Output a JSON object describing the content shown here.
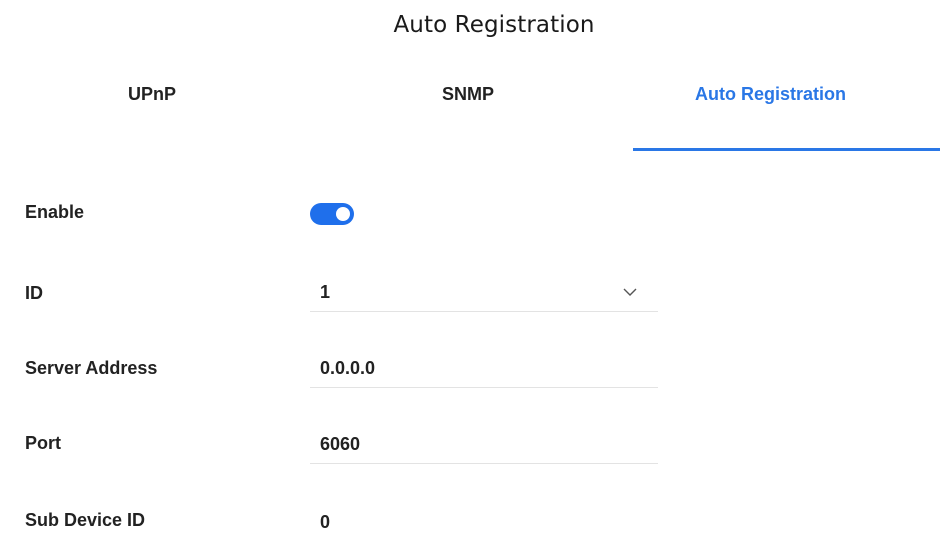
{
  "header": {
    "title": "Auto Registration"
  },
  "tabs": [
    {
      "label": "UPnP",
      "active": false
    },
    {
      "label": "SNMP",
      "active": false
    },
    {
      "label": "Auto Registration",
      "active": true
    }
  ],
  "form": {
    "enable": {
      "label": "Enable",
      "value": true
    },
    "id": {
      "label": "ID",
      "value": "1"
    },
    "server_address": {
      "label": "Server Address",
      "value": "0.0.0.0"
    },
    "port": {
      "label": "Port",
      "value": "6060"
    },
    "sub_device_id": {
      "label": "Sub Device ID",
      "value": "0"
    }
  },
  "icons": {
    "dropdown": "chevron-down-icon"
  },
  "colors": {
    "accent": "#2a77e6",
    "toggle_on": "#1f6feb",
    "text": "#222222",
    "divider": "#e3e3e3"
  }
}
